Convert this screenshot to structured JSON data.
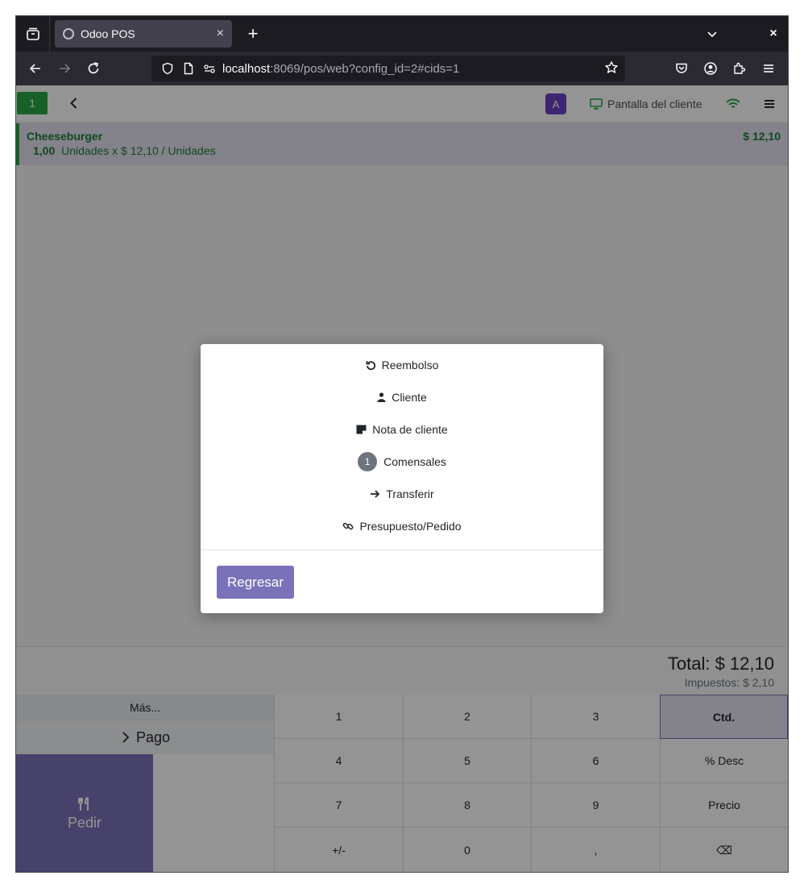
{
  "browser": {
    "tab_title": "Odoo POS",
    "tab_close": "×",
    "new_tab": "+",
    "window_close": "×",
    "url_host": "localhost",
    "url_path": ":8069/pos/web?config_id=2#cids=1"
  },
  "header": {
    "order_number": "1",
    "avatar_initial": "A",
    "customer_display_label": "Pantalla del cliente"
  },
  "orderline": {
    "product": "Cheeseburger",
    "price": "$ 12,10",
    "quantity": "1,00",
    "detail": "Unidades x $ 12,10 / Unidades"
  },
  "totals": {
    "total": "Total: $ 12,10",
    "taxes": "Impuestos: $ 2,10"
  },
  "controls": {
    "more_label": "Más...",
    "pay_label": "Pago",
    "order_label": "Pedir"
  },
  "numpad": {
    "keys": [
      "1",
      "2",
      "3",
      "Ctd.",
      "4",
      "5",
      "6",
      "% Desc",
      "7",
      "8",
      "9",
      "Precio",
      "+/-",
      "0",
      ",",
      "⌫"
    ],
    "active": "Ctd."
  },
  "modal": {
    "items": [
      {
        "label": "Reembolso",
        "icon": "undo-icon"
      },
      {
        "label": "Cliente",
        "icon": "user-icon"
      },
      {
        "label": "Nota de cliente",
        "icon": "note-icon"
      },
      {
        "label": "Comensales",
        "icon": "guest-count-badge",
        "count": "1"
      },
      {
        "label": "Transferir",
        "icon": "arrow-right-icon"
      },
      {
        "label": "Presupuesto/Pedido",
        "icon": "link-icon"
      }
    ],
    "return_label": "Regresar"
  },
  "colors": {
    "accent": "#7a72b8",
    "success": "#28a745",
    "avatar": "#6f42c1"
  }
}
